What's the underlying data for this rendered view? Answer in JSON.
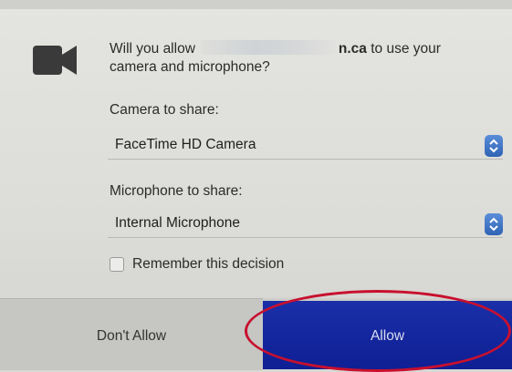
{
  "prompt": {
    "line1_before": "Will you allow",
    "line1_domain_suffix": "n.ca",
    "line1_after": "to use your",
    "line2": "camera and microphone?"
  },
  "camera": {
    "label": "Camera to share:",
    "selected": "FaceTime HD Camera"
  },
  "microphone": {
    "label": "Microphone to share:",
    "selected": "Internal Microphone"
  },
  "remember": {
    "label": "Remember this decision",
    "checked": false
  },
  "buttons": {
    "deny": "Don't Allow",
    "allow": "Allow"
  },
  "colors": {
    "allow_button": "#14259e",
    "stepper": "#3f74c6",
    "annotation_ring": "#c8102e"
  }
}
